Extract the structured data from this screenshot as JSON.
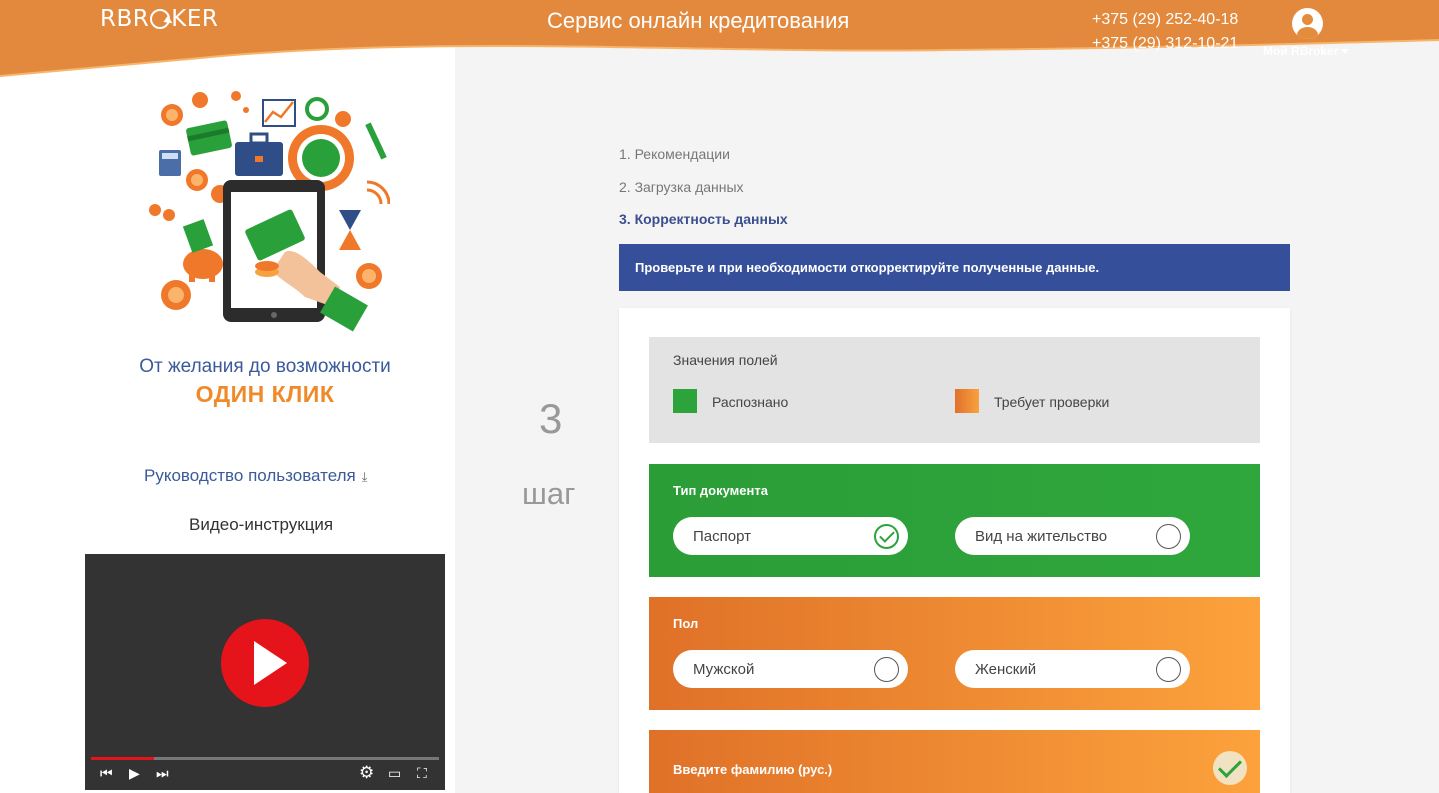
{
  "header": {
    "logo_text": "RBROKER",
    "title": "Сервис онлайн кредитования",
    "phones": [
      "+375 (29) 252-40-18",
      "+375 (29) 312-10-21"
    ],
    "account_label": "Мой RBroker",
    "brand_color": "#e38c3b"
  },
  "sidebar": {
    "slogan_line1": "От желания до возможности",
    "slogan_line2": "ОДИН КЛИК",
    "guide_link": "Руководство пользователя",
    "video_title": "Видео-инструкция",
    "video_progress_fraction": 0.18
  },
  "step": {
    "number": "3",
    "word": "шаг"
  },
  "steps": [
    {
      "label": "1. Рекомендации",
      "active": false
    },
    {
      "label": "2. Загрузка данных",
      "active": false
    },
    {
      "label": "3. Корректность данных",
      "active": true
    }
  ],
  "notice": "Проверьте и при необходимости откорректируйте полученные данные.",
  "legend": {
    "title": "Значения полей",
    "recognized": "Распознано",
    "needs_check": "Требует проверки"
  },
  "fields": {
    "doc_type": {
      "label": "Тип документа",
      "options": [
        "Паспорт",
        "Вид на жительство"
      ],
      "selected": "Паспорт"
    },
    "gender": {
      "label": "Пол",
      "options": [
        "Мужской",
        "Женский"
      ],
      "selected": null
    },
    "surname": {
      "label": "Введите фамилию (рус.)"
    }
  },
  "colors": {
    "recognized": "#2da33c",
    "needs_check": "#f39b37",
    "notice_bg": "#354f9a",
    "slogan_blue": "#3b5a9a",
    "slogan_orange": "#ef8a2a"
  }
}
